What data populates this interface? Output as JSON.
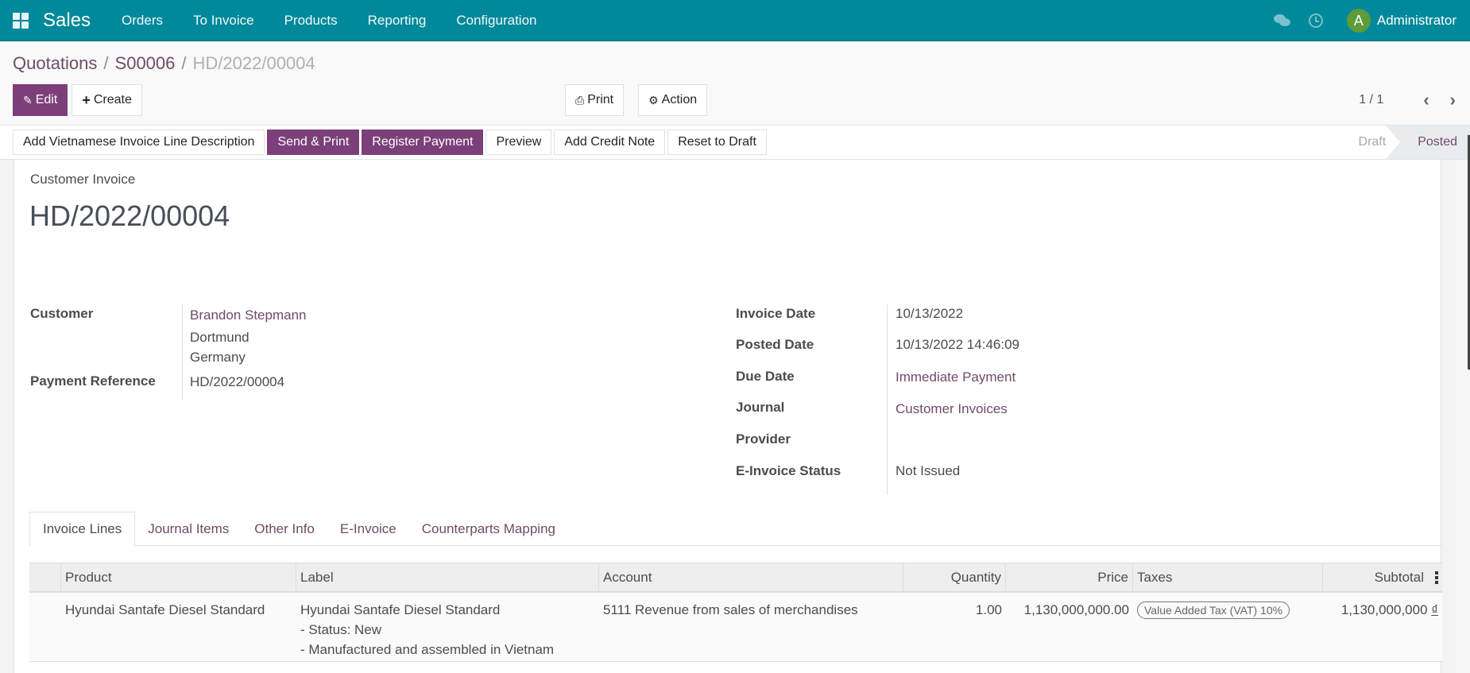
{
  "navbar": {
    "app_name": "Sales",
    "menu": [
      "Orders",
      "To Invoice",
      "Products",
      "Reporting",
      "Configuration"
    ],
    "user_initial": "A",
    "user_name": "Administrator",
    "icons": [
      "apps-grid-icon",
      "chat-icon",
      "activity-clock-icon"
    ]
  },
  "breadcrumb": {
    "items": [
      "Quotations",
      "S00006"
    ],
    "current": "HD/2022/00004",
    "separator": "/"
  },
  "control_panel": {
    "edit_label": "Edit",
    "create_label": "Create",
    "print_label": "Print",
    "action_label": "Action",
    "pager_value": "1 / 1"
  },
  "statusbar": {
    "buttons": [
      {
        "label": "Add Vietnamese Invoice Line Description",
        "primary": false
      },
      {
        "label": "Send & Print",
        "primary": true
      },
      {
        "label": "Register Payment",
        "primary": true
      },
      {
        "label": "Preview",
        "primary": false
      },
      {
        "label": "Add Credit Note",
        "primary": false
      },
      {
        "label": "Reset to Draft",
        "primary": false
      }
    ],
    "stages": [
      "Draft",
      "Posted"
    ],
    "current_stage": "Posted"
  },
  "form": {
    "doc_type": "Customer Invoice",
    "title": "HD/2022/00004",
    "left_fields": {
      "customer_label": "Customer",
      "customer_name": "Brandon Stepmann",
      "customer_city": "Dortmund",
      "customer_country": "Germany",
      "payment_reference_label": "Payment Reference",
      "payment_reference": "HD/2022/00004"
    },
    "right_fields": [
      {
        "label": "Invoice Date",
        "value": "10/13/2022",
        "link": false
      },
      {
        "label": "Posted Date",
        "value": "10/13/2022 14:46:09",
        "link": false
      },
      {
        "label": "Due Date",
        "value": "Immediate Payment",
        "link": true
      },
      {
        "label": "Journal",
        "value": "Customer Invoices",
        "link": true
      },
      {
        "label": "Provider",
        "value": "",
        "link": false
      },
      {
        "label": "E-Invoice Status",
        "value": "Not Issued",
        "link": false
      }
    ]
  },
  "tabs": [
    "Invoice Lines",
    "Journal Items",
    "Other Info",
    "E-Invoice",
    "Counterparts Mapping"
  ],
  "active_tab": "Invoice Lines",
  "invoice_lines": {
    "columns": [
      "Product",
      "Label",
      "Account",
      "Quantity",
      "Price",
      "Taxes",
      "Subtotal"
    ],
    "rows": [
      {
        "product": "Hyundai Santafe Diesel Standard",
        "label_lines": [
          "Hyundai Santafe Diesel Standard",
          "- Status: New",
          "- Manufactured and assembled in Vietnam"
        ],
        "account": "5111 Revenue from sales of merchandises",
        "quantity": "1.00",
        "price": "1,130,000,000.00",
        "taxes": "Value Added Tax (VAT) 10%",
        "subtotal": "1,130,000,000",
        "currency": "₫"
      }
    ]
  },
  "colors": {
    "navbar": "#00899a",
    "primary": "#7c3f79",
    "link": "#714b67"
  }
}
